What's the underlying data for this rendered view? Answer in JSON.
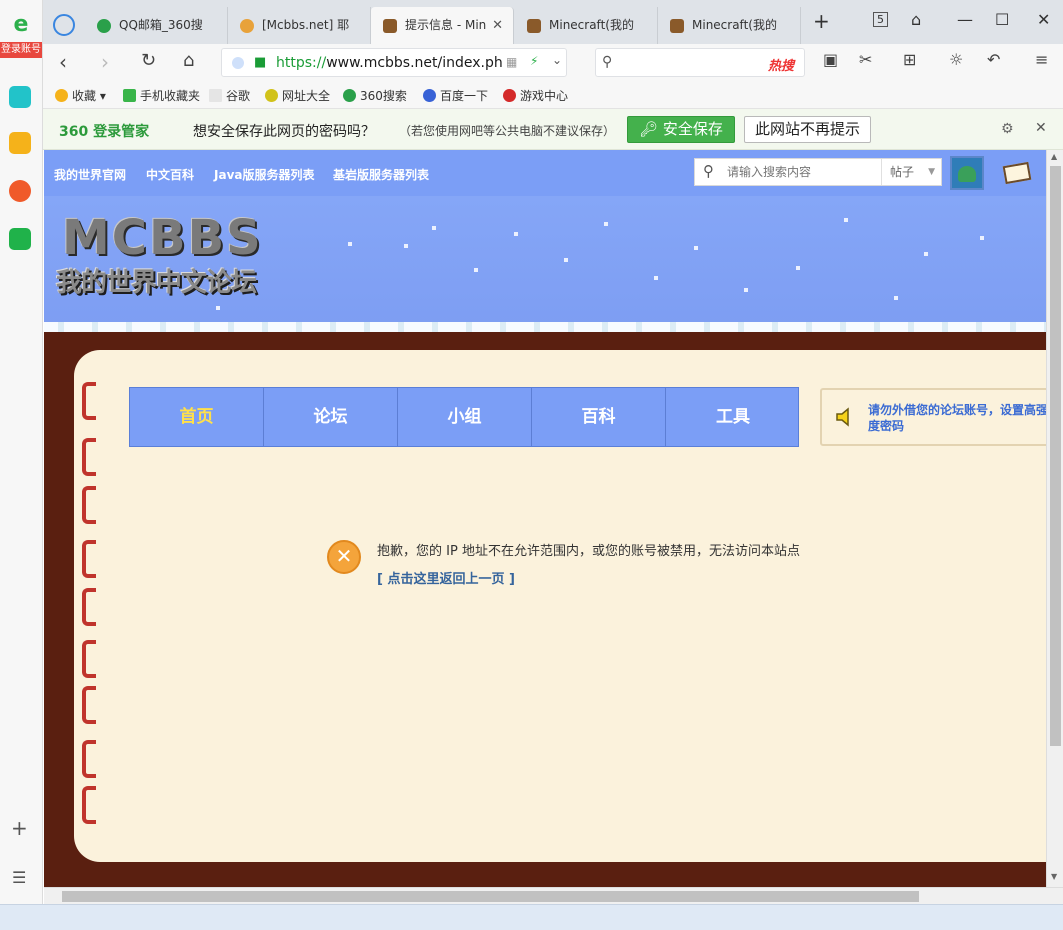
{
  "leftbar": {
    "login": "登录账号"
  },
  "tabs": [
    {
      "label": "QQ邮箱_360搜",
      "fav": "#2aa04a"
    },
    {
      "label": "[Mcbbs.net] 耶",
      "fav": "#e8a23a"
    },
    {
      "label": "提示信息 - Min",
      "fav": "#8a5a2a"
    },
    {
      "label": "Minecraft(我的",
      "fav": "#8a5a2a"
    },
    {
      "label": "Minecraft(我的",
      "fav": "#8a5a2a"
    }
  ],
  "tab_count": "5",
  "address": {
    "scheme": "https://",
    "host": "www.mcbbs.net/index.ph"
  },
  "search": {
    "placeholder": "",
    "hot": "热搜"
  },
  "bookmarks": [
    "收藏",
    "手机收藏夹",
    "谷歌",
    "网址大全",
    "360搜索",
    "百度一下",
    "游戏中心"
  ],
  "pwbar": {
    "brand": "360 登录管家",
    "message": "想安全保存此网页的密码吗？",
    "sub": "（若您使用网吧等公共电脑不建议保存）",
    "save": "安全保存",
    "never": "此网站不再提示"
  },
  "site": {
    "topnav": [
      "我的世界官网",
      "中文百科",
      "Java版服务器列表",
      "基岩版服务器列表"
    ],
    "search_placeholder": "请输入搜索内容",
    "search_type": "帖子",
    "logo_big": "MCBBS",
    "logo_small": "我的世界中文论坛",
    "menu": [
      "首页",
      "论坛",
      "小组",
      "百科",
      "工具"
    ],
    "notice": "请勿外借您的论坛账号，设置高强度密码",
    "error_message": "抱歉，您的 IP 地址不在允许范围内，或您的账号被禁用，无法访问本站点",
    "back_link": "[ 点击这里返回上一页 ]"
  },
  "colors": {
    "accent_green": "#44b14c",
    "site_blue": "#7b9ef6",
    "frame_brown": "#5a1f10",
    "paper": "#fbf2dc"
  }
}
